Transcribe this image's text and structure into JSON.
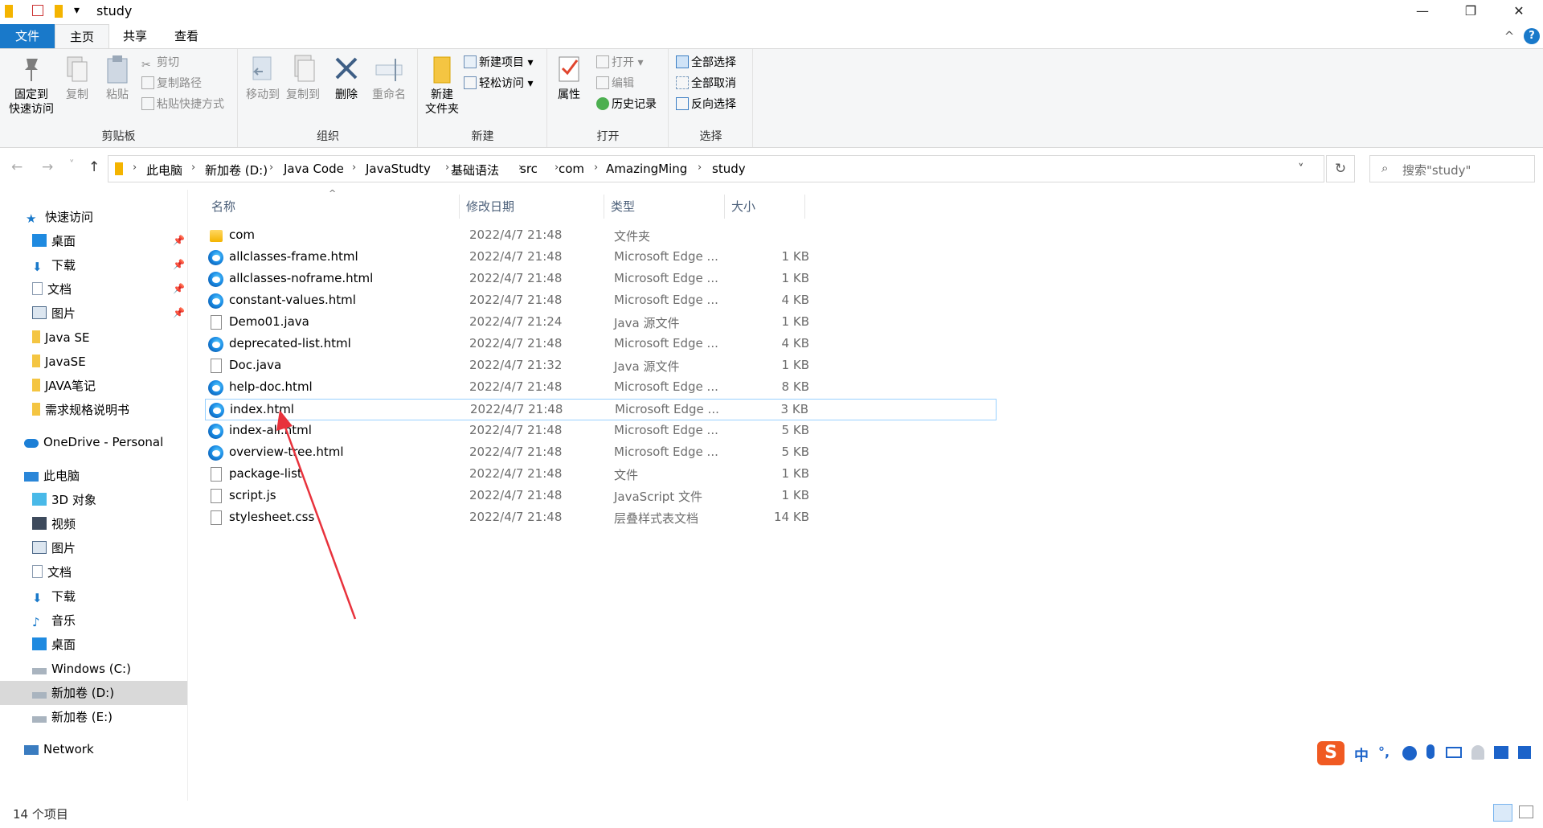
{
  "titlebar": {
    "title": "study",
    "qa_dropdown": "▾",
    "minimize": "—",
    "restore": "❐",
    "close": "✕"
  },
  "tabs": {
    "file": "文件",
    "home": "主页",
    "share": "共享",
    "view": "查看",
    "collapse": "^",
    "help": "?"
  },
  "ribbon": {
    "clipboard": {
      "label": "剪贴板",
      "pin_line1": "固定到",
      "pin_line2": "快速访问",
      "copy": "复制",
      "paste": "粘贴",
      "cut": "剪切",
      "copy_path": "复制路径",
      "paste_shortcut": "粘贴快捷方式"
    },
    "organize": {
      "label": "组织",
      "move_to": "移动到",
      "copy_to": "复制到",
      "delete": "删除",
      "rename": "重命名"
    },
    "new": {
      "label": "新建",
      "new_folder_line1": "新建",
      "new_folder_line2": "文件夹",
      "new_item": "新建项目 ▾",
      "easy_access": "轻松访问 ▾"
    },
    "open": {
      "label": "打开",
      "properties": "属性",
      "open": "打开 ▾",
      "edit": "编辑",
      "history": "历史记录"
    },
    "select": {
      "label": "选择",
      "select_all": "全部选择",
      "select_none": "全部取消",
      "invert": "反向选择"
    }
  },
  "nav": {
    "back": "←",
    "forward": "→",
    "recent": "˅",
    "up": "↑",
    "breadcrumbs": [
      "此电脑",
      "新加卷 (D:)",
      "Java Code",
      "JavaStudty",
      "基础语法",
      "src",
      "com",
      "AmazingMing",
      "study"
    ],
    "dropdown": "˅",
    "refresh": "↻",
    "search_placeholder": "搜索\"study\""
  },
  "sidebar": {
    "quick_access": "快速访问",
    "quick_items": [
      "桌面",
      "下载",
      "文档",
      "图片",
      "Java SE",
      "JavaSE",
      "JAVA笔记",
      "需求规格说明书"
    ],
    "onedrive": "OneDrive - Personal",
    "this_pc": "此电脑",
    "pc_items": [
      "3D 对象",
      "视频",
      "图片",
      "文档",
      "下载",
      "音乐",
      "桌面",
      "Windows (C:)",
      "新加卷 (D:)",
      "新加卷 (E:)"
    ],
    "network": "Network"
  },
  "columns": {
    "name": "名称",
    "modified": "修改日期",
    "type": "类型",
    "size": "大小",
    "sort_arrow": "^"
  },
  "files": [
    {
      "name": "com",
      "modified": "2022/4/7 21:48",
      "type": "文件夹",
      "size": "",
      "icon": "folder-icon"
    },
    {
      "name": "allclasses-frame.html",
      "modified": "2022/4/7 21:48",
      "type": "Microsoft Edge ...",
      "size": "1 KB",
      "icon": "edge-icon"
    },
    {
      "name": "allclasses-noframe.html",
      "modified": "2022/4/7 21:48",
      "type": "Microsoft Edge ...",
      "size": "1 KB",
      "icon": "edge-icon"
    },
    {
      "name": "constant-values.html",
      "modified": "2022/4/7 21:48",
      "type": "Microsoft Edge ...",
      "size": "4 KB",
      "icon": "edge-icon"
    },
    {
      "name": "Demo01.java",
      "modified": "2022/4/7 21:24",
      "type": "Java 源文件",
      "size": "1 KB",
      "icon": "java-file-icon"
    },
    {
      "name": "deprecated-list.html",
      "modified": "2022/4/7 21:48",
      "type": "Microsoft Edge ...",
      "size": "4 KB",
      "icon": "edge-icon"
    },
    {
      "name": "Doc.java",
      "modified": "2022/4/7 21:32",
      "type": "Java 源文件",
      "size": "1 KB",
      "icon": "java-file-icon"
    },
    {
      "name": "help-doc.html",
      "modified": "2022/4/7 21:48",
      "type": "Microsoft Edge ...",
      "size": "8 KB",
      "icon": "edge-icon"
    },
    {
      "name": "index.html",
      "modified": "2022/4/7 21:48",
      "type": "Microsoft Edge ...",
      "size": "3 KB",
      "icon": "edge-icon"
    },
    {
      "name": "index-all.html",
      "modified": "2022/4/7 21:48",
      "type": "Microsoft Edge ...",
      "size": "5 KB",
      "icon": "edge-icon"
    },
    {
      "name": "overview-tree.html",
      "modified": "2022/4/7 21:48",
      "type": "Microsoft Edge ...",
      "size": "5 KB",
      "icon": "edge-icon"
    },
    {
      "name": "package-list",
      "modified": "2022/4/7 21:48",
      "type": "文件",
      "size": "1 KB",
      "icon": "file-icon"
    },
    {
      "name": "script.js",
      "modified": "2022/4/7 21:48",
      "type": "JavaScript 文件",
      "size": "1 KB",
      "icon": "js-file-icon"
    },
    {
      "name": "stylesheet.css",
      "modified": "2022/4/7 21:48",
      "type": "层叠样式表文档",
      "size": "14 KB",
      "icon": "css-file-icon"
    }
  ],
  "selected_row": "index.html",
  "status": {
    "count": "14 个项目"
  },
  "ime": {
    "logo": "S",
    "lang": "中",
    "punct": "°,"
  },
  "colors": {
    "accent": "#1979ca",
    "selected_border": "#99d1ff",
    "arrow": "#e8323c"
  }
}
